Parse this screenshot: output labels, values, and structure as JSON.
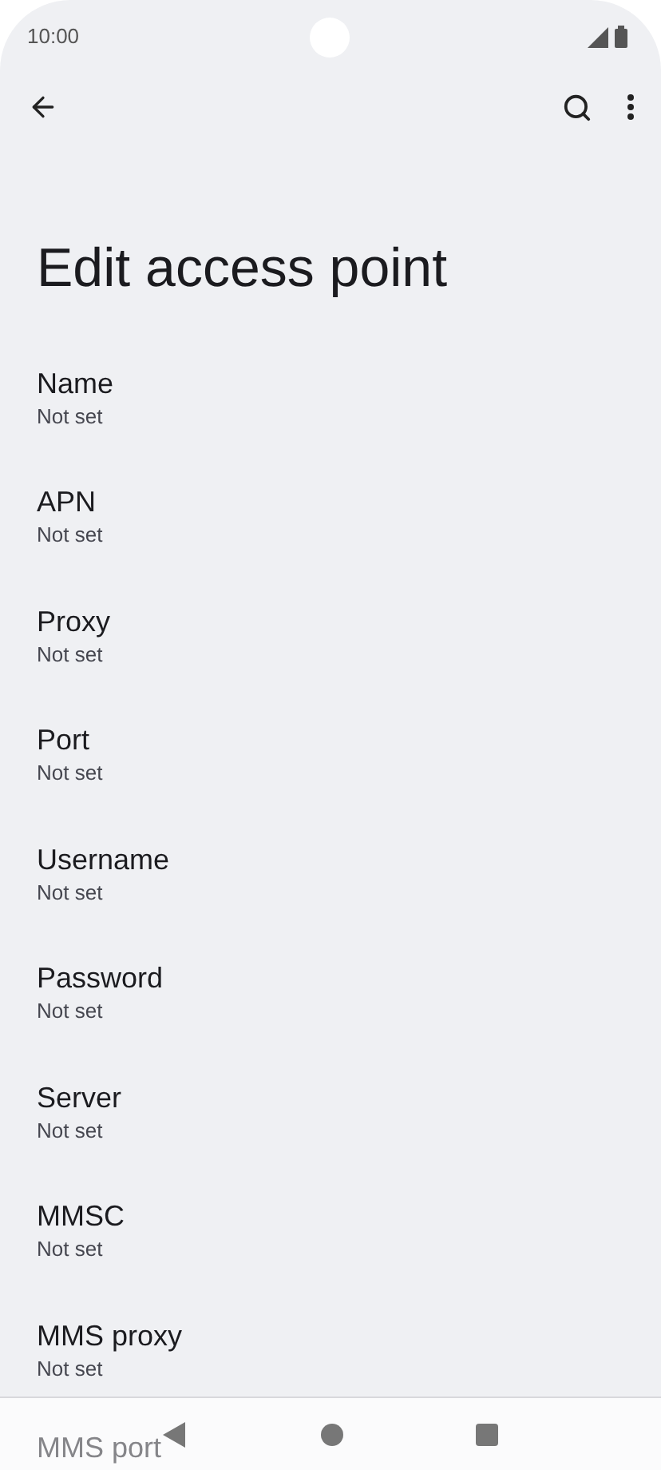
{
  "status_bar": {
    "time": "10:00"
  },
  "title": "Edit access point",
  "settings": [
    {
      "label": "Name",
      "value": "Not set"
    },
    {
      "label": "APN",
      "value": "Not set"
    },
    {
      "label": "Proxy",
      "value": "Not set"
    },
    {
      "label": "Port",
      "value": "Not set"
    },
    {
      "label": "Username",
      "value": "Not set"
    },
    {
      "label": "Password",
      "value": "Not set"
    },
    {
      "label": "Server",
      "value": "Not set"
    },
    {
      "label": "MMSC",
      "value": "Not set"
    },
    {
      "label": "MMS proxy",
      "value": "Not set"
    },
    {
      "label": "MMS port"
    }
  ]
}
